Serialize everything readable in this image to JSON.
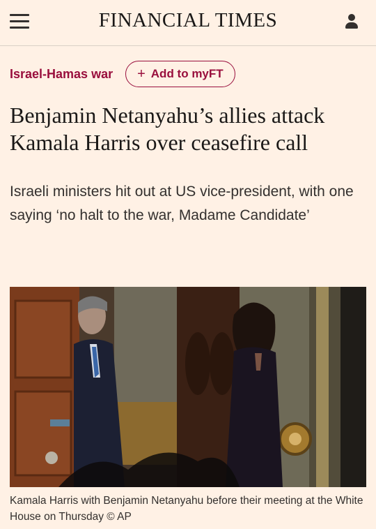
{
  "header": {
    "brand": "FINANCIAL TIMES",
    "menu_icon": "hamburger-menu-icon",
    "user_icon": "user-icon"
  },
  "tags": {
    "topic": "Israel-Hamas war",
    "myft_label": "Add to myFT",
    "myft_icon": "+"
  },
  "article": {
    "headline": "Benjamin Netanyahu’s allies attack Kamala Harris over ceasefire call",
    "standfirst": "Israeli ministers hit out at US vice-president, with one saying ‘no halt to the war, Madame Candidate’",
    "caption": "Kamala Harris with Benjamin Netanyahu before their meeting at the White House on Thursday © AP"
  },
  "colors": {
    "background": "#fff1e5",
    "accent": "#990f3d",
    "text": "#33302e"
  }
}
